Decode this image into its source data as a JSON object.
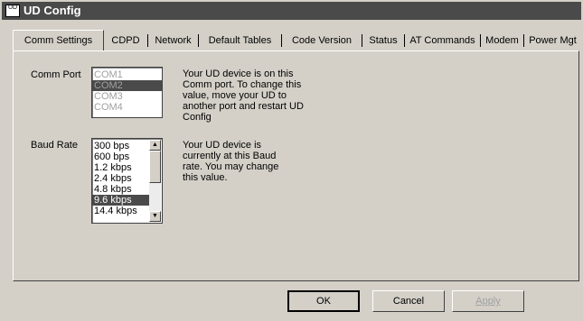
{
  "window": {
    "title": "UD Config",
    "icon_text": "UD"
  },
  "tabs": [
    {
      "label": "Comm Settings",
      "active": true
    },
    {
      "label": "CDPD"
    },
    {
      "label": "Network"
    },
    {
      "label": "Default Tables"
    },
    {
      "label": "Code Version"
    },
    {
      "label": "Status"
    },
    {
      "label": "AT Commands"
    },
    {
      "label": "Modem"
    },
    {
      "label": "Power Mgt"
    }
  ],
  "comm_port": {
    "label": "Comm Port",
    "options": [
      "COM1",
      "COM2",
      "COM3",
      "COM4"
    ],
    "selected": "COM2",
    "description": "Your UD device is on this Comm port.  To change this value, move your UD to another port and restart UD Config"
  },
  "baud_rate": {
    "label": "Baud Rate",
    "options": [
      "300 bps",
      "600 bps",
      "1.2 kbps",
      "2.4 kbps",
      "4.8 kbps",
      "9.6 kbps",
      "14.4 kbps"
    ],
    "selected": "9.6 kbps",
    "description": "Your UD device is currently at this Baud rate.  You may change this value."
  },
  "buttons": {
    "ok": "OK",
    "cancel": "Cancel",
    "apply": "Apply"
  },
  "icons": {
    "scroll_up": "arrow-up-icon",
    "scroll_down": "arrow-down-icon"
  }
}
